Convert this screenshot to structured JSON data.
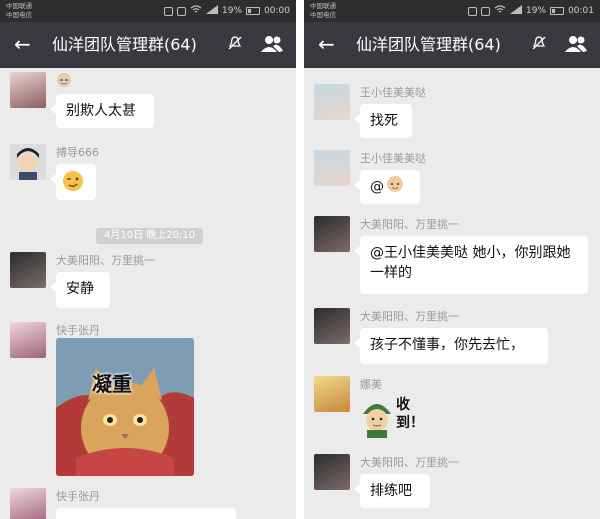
{
  "status": {
    "carrier_line1": "中国联通",
    "carrier_line2": "中国电信",
    "left_battery": "19%",
    "left_time": "00:00",
    "right_battery": "19%",
    "right_time": "00:01"
  },
  "header": {
    "title": "仙洋团队管理群(64)"
  },
  "left_chat": {
    "m1_text": "别欺人太甚",
    "m2_sender": "搏导666",
    "timestamp": "4月10日 晚上20:10",
    "m3_sender": "大美阳阳、万里挑一",
    "m3_text": "安静",
    "m4_sender": "快手张丹",
    "m4_caption": "凝重",
    "m5_sender": "快手张丹"
  },
  "right_chat": {
    "m1_sender": "王小佳美美哒",
    "m1_text": "找死",
    "m2_sender": "王小佳美美哒",
    "m2_text": "@",
    "m3_sender": "大美阳阳、万里挑一",
    "m3_text": "@王小佳美美哒  她小，你别跟她一样的",
    "m4_sender": "大美阳阳、万里挑一",
    "m4_text": "孩子不懂事，你先去忙，",
    "m5_sender": "娜美",
    "m5_text": "收到！",
    "m6_sender": "大美阳阳、万里挑一",
    "m6_text": "排练吧"
  },
  "icons": [
    "back-arrow-icon",
    "mute-bell-icon",
    "group-members-icon",
    "wifi-icon",
    "signal-icon",
    "battery-icon",
    "baby-face-emoji",
    "wink-face-emoji",
    "cat-sticker",
    "soldier-sticker"
  ],
  "colors": {
    "topbar": "#393a3f",
    "chat_bg": "#ebebeb",
    "bubble": "#ffffff",
    "statusbar": "#2e2e2e"
  }
}
